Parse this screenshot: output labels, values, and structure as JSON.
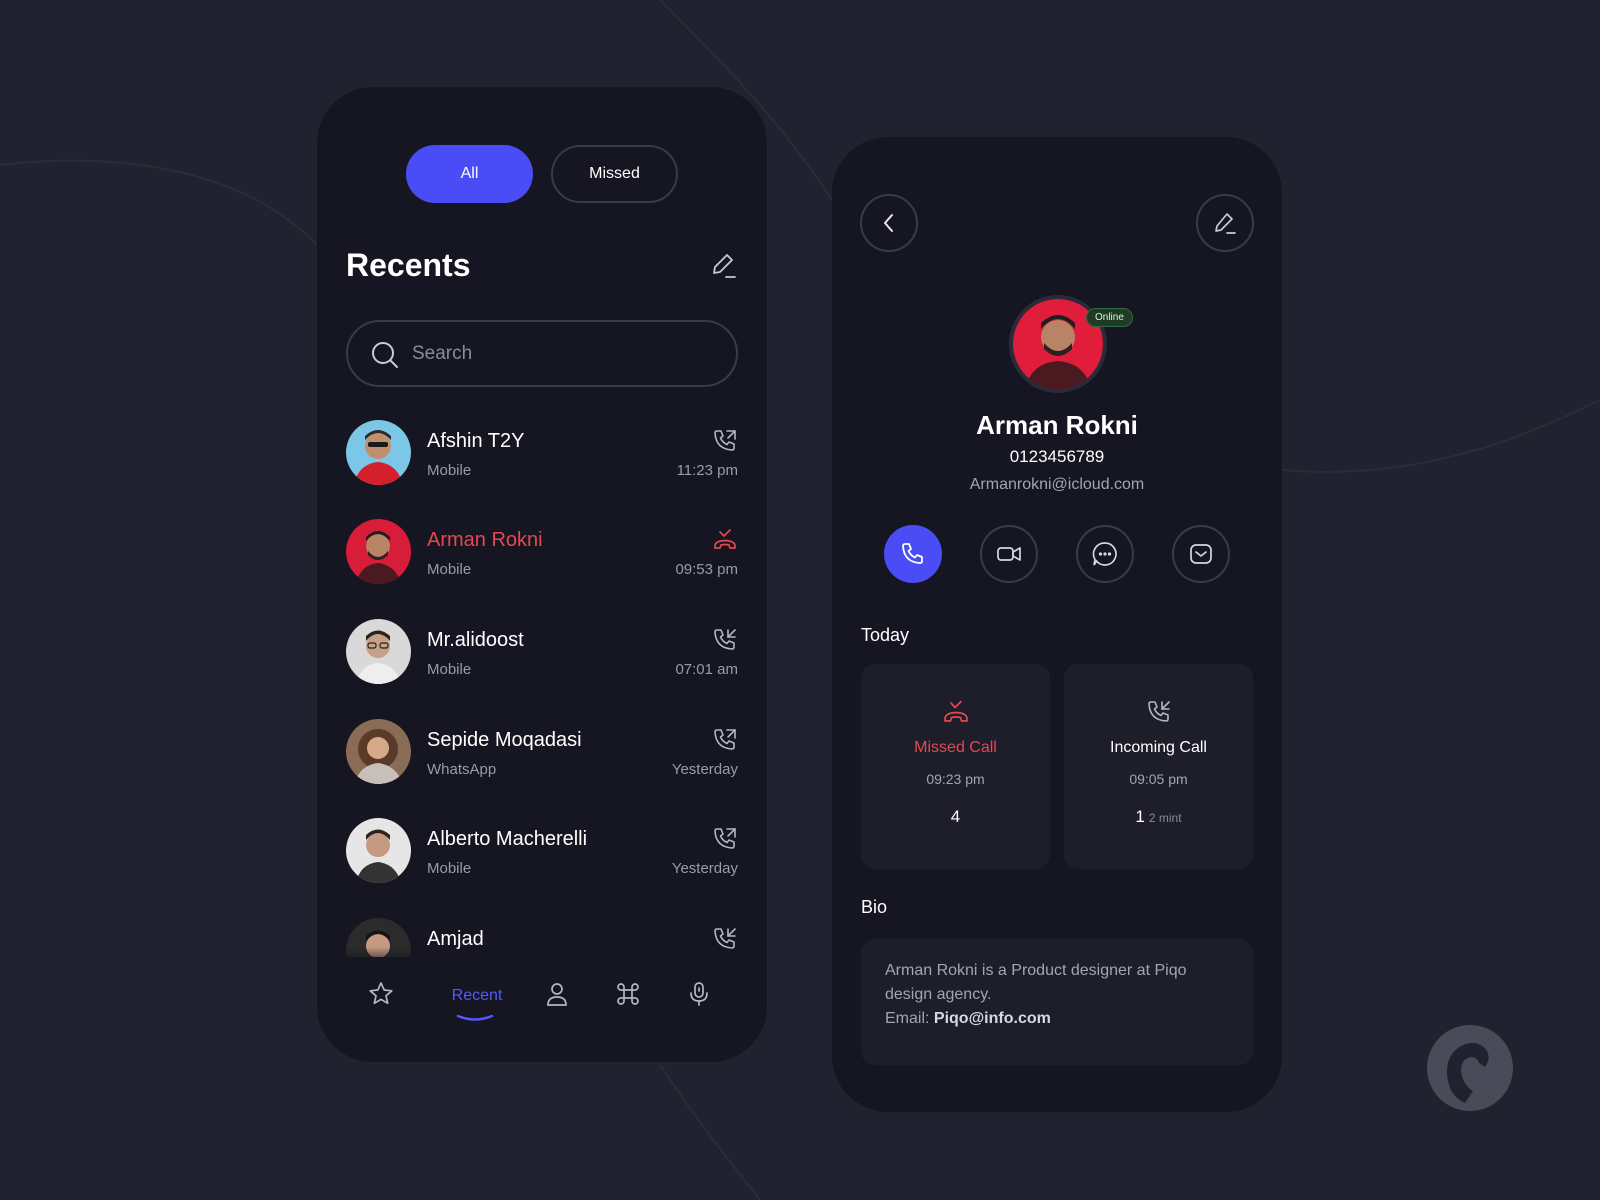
{
  "recents_screen": {
    "filter_tabs": [
      {
        "label": "All",
        "active": true
      },
      {
        "label": "Missed",
        "active": false
      }
    ],
    "title": "Recents",
    "search": {
      "placeholder": "Search",
      "value": ""
    },
    "contacts": [
      {
        "name": "Afshin T2Y",
        "type": "Mobile",
        "time": "11:23 pm",
        "call_icon": "outgoing-call-icon",
        "missed": false,
        "avatar_color": "#7cc7e8"
      },
      {
        "name": "Arman Rokni",
        "type": "Mobile",
        "time": "09:53 pm",
        "call_icon": "missed-call-icon",
        "missed": true,
        "avatar_color": "#d71d3a"
      },
      {
        "name": "Mr.alidoost",
        "type": "Mobile",
        "time": "07:01 am",
        "call_icon": "incoming-call-icon",
        "missed": false,
        "avatar_color": "#d9d9d9"
      },
      {
        "name": "Sepide Moqadasi",
        "type": "WhatsApp",
        "time": "Yesterday",
        "call_icon": "outgoing-call-icon",
        "missed": false,
        "avatar_color": "#8a6b55"
      },
      {
        "name": "Alberto Macherelli",
        "type": "Mobile",
        "time": "Yesterday",
        "call_icon": "outgoing-call-icon",
        "missed": false,
        "avatar_color": "#e6e6e6"
      },
      {
        "name": "Amjad",
        "type": "",
        "time": "",
        "call_icon": "incoming-call-icon",
        "missed": false,
        "avatar_color": "#2b2b2b"
      }
    ],
    "bottom_nav": [
      {
        "icon": "star-icon"
      },
      {
        "label": "Recent",
        "active": true
      },
      {
        "icon": "user-icon"
      },
      {
        "icon": "command-icon"
      },
      {
        "icon": "microphone-icon"
      }
    ]
  },
  "detail_screen": {
    "status": "Online",
    "name": "Arman Rokni",
    "phone": "0123456789",
    "email": "Armanrokni@icloud.com",
    "actions": [
      "phone-icon",
      "video-icon",
      "message-icon",
      "mail-icon"
    ],
    "today_label": "Today",
    "cards": [
      {
        "label": "Missed Call",
        "time": "09:23 pm",
        "count": "4",
        "duration": "",
        "icon": "missed-call-icon"
      },
      {
        "label": "Incoming Call",
        "time": "09:05 pm",
        "count": "1",
        "duration": "2 mint",
        "icon": "incoming-call-icon"
      }
    ],
    "bio_label": "Bio",
    "bio_text": "Arman Rokni is a Product designer at Piqo design agency.",
    "bio_email_label": "Email:",
    "bio_email": "Piqo@info.com"
  },
  "colors": {
    "background": "#21222f",
    "phone": "#151621",
    "accent": "#4a4cf5",
    "missed": "#e7474e",
    "online": "#1f3a25"
  }
}
